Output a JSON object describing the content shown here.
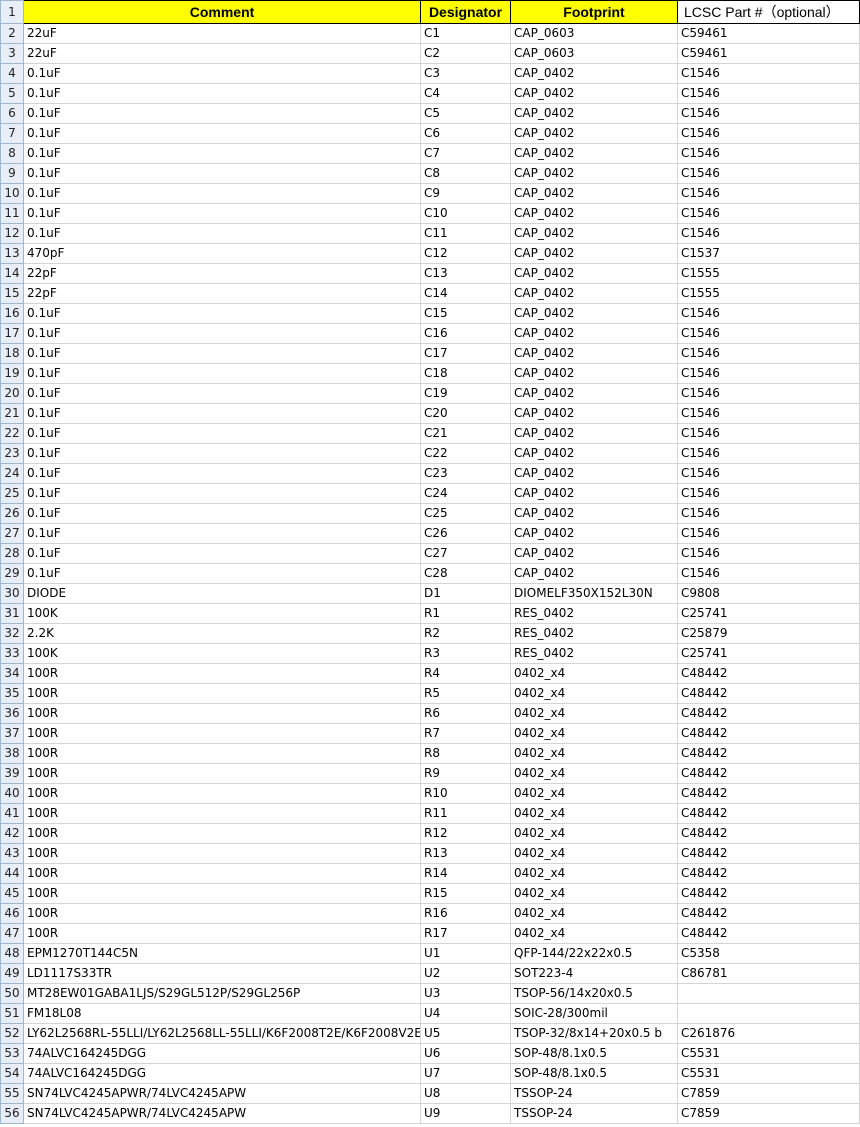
{
  "headers": [
    "Comment",
    "Designator",
    "Footprint",
    "LCSC Part #（optional）"
  ],
  "header_row_number": "1",
  "rows": [
    [
      "2",
      "22uF",
      "C1",
      "CAP_0603",
      "C59461"
    ],
    [
      "3",
      "22uF",
      "C2",
      "CAP_0603",
      "C59461"
    ],
    [
      "4",
      "0.1uF",
      "C3",
      "CAP_0402",
      "C1546"
    ],
    [
      "5",
      "0.1uF",
      "C4",
      "CAP_0402",
      "C1546"
    ],
    [
      "6",
      "0.1uF",
      "C5",
      "CAP_0402",
      "C1546"
    ],
    [
      "7",
      "0.1uF",
      "C6",
      "CAP_0402",
      "C1546"
    ],
    [
      "8",
      "0.1uF",
      "C7",
      "CAP_0402",
      "C1546"
    ],
    [
      "9",
      "0.1uF",
      "C8",
      "CAP_0402",
      "C1546"
    ],
    [
      "10",
      "0.1uF",
      "C9",
      "CAP_0402",
      "C1546"
    ],
    [
      "11",
      "0.1uF",
      "C10",
      "CAP_0402",
      "C1546"
    ],
    [
      "12",
      "0.1uF",
      "C11",
      "CAP_0402",
      "C1546"
    ],
    [
      "13",
      "470pF",
      "C12",
      "CAP_0402",
      "C1537"
    ],
    [
      "14",
      "22pF",
      "C13",
      "CAP_0402",
      "C1555"
    ],
    [
      "15",
      "22pF",
      "C14",
      "CAP_0402",
      "C1555"
    ],
    [
      "16",
      "0.1uF",
      "C15",
      "CAP_0402",
      "C1546"
    ],
    [
      "17",
      "0.1uF",
      "C16",
      "CAP_0402",
      "C1546"
    ],
    [
      "18",
      "0.1uF",
      "C17",
      "CAP_0402",
      "C1546"
    ],
    [
      "19",
      "0.1uF",
      "C18",
      "CAP_0402",
      "C1546"
    ],
    [
      "20",
      "0.1uF",
      "C19",
      "CAP_0402",
      "C1546"
    ],
    [
      "21",
      "0.1uF",
      "C20",
      "CAP_0402",
      "C1546"
    ],
    [
      "22",
      "0.1uF",
      "C21",
      "CAP_0402",
      "C1546"
    ],
    [
      "23",
      "0.1uF",
      "C22",
      "CAP_0402",
      "C1546"
    ],
    [
      "24",
      "0.1uF",
      "C23",
      "CAP_0402",
      "C1546"
    ],
    [
      "25",
      "0.1uF",
      "C24",
      "CAP_0402",
      "C1546"
    ],
    [
      "26",
      "0.1uF",
      "C25",
      "CAP_0402",
      "C1546"
    ],
    [
      "27",
      "0.1uF",
      "C26",
      "CAP_0402",
      "C1546"
    ],
    [
      "28",
      "0.1uF",
      "C27",
      "CAP_0402",
      "C1546"
    ],
    [
      "29",
      "0.1uF",
      "C28",
      "CAP_0402",
      "C1546"
    ],
    [
      "30",
      "DIODE",
      "D1",
      "DIOMELF350X152L30N",
      "C9808"
    ],
    [
      "31",
      "100K",
      "R1",
      "RES_0402",
      "C25741"
    ],
    [
      "32",
      "2.2K",
      "R2",
      "RES_0402",
      "C25879"
    ],
    [
      "33",
      "100K",
      "R3",
      "RES_0402",
      "C25741"
    ],
    [
      "34",
      "100R",
      "R4",
      "0402_x4",
      "C48442"
    ],
    [
      "35",
      "100R",
      "R5",
      "0402_x4",
      "C48442"
    ],
    [
      "36",
      "100R",
      "R6",
      "0402_x4",
      "C48442"
    ],
    [
      "37",
      "100R",
      "R7",
      "0402_x4",
      "C48442"
    ],
    [
      "38",
      "100R",
      "R8",
      "0402_x4",
      "C48442"
    ],
    [
      "39",
      "100R",
      "R9",
      "0402_x4",
      "C48442"
    ],
    [
      "40",
      "100R",
      "R10",
      "0402_x4",
      "C48442"
    ],
    [
      "41",
      "100R",
      "R11",
      "0402_x4",
      "C48442"
    ],
    [
      "42",
      "100R",
      "R12",
      "0402_x4",
      "C48442"
    ],
    [
      "43",
      "100R",
      "R13",
      "0402_x4",
      "C48442"
    ],
    [
      "44",
      "100R",
      "R14",
      "0402_x4",
      "C48442"
    ],
    [
      "45",
      "100R",
      "R15",
      "0402_x4",
      "C48442"
    ],
    [
      "46",
      "100R",
      "R16",
      "0402_x4",
      "C48442"
    ],
    [
      "47",
      "100R",
      "R17",
      "0402_x4",
      "C48442"
    ],
    [
      "48",
      "EPM1270T144C5N",
      "U1",
      "QFP-144/22x22x0.5",
      "C5358"
    ],
    [
      "49",
      "LD1117S33TR",
      "U2",
      "SOT223-4",
      "C86781"
    ],
    [
      "50",
      "MT28EW01GABA1LJS/S29GL512P/S29GL256P",
      "U3",
      "TSOP-56/14x20x0.5",
      ""
    ],
    [
      "51",
      "FM18L08",
      "U4",
      "SOIC-28/300mil",
      ""
    ],
    [
      "52",
      "LY62L2568RL-55LLI/LY62L2568LL-55LLI/K6F2008T2E/K6F2008V2E",
      "U5",
      "TSOP-32/8x14+20x0.5 b",
      "C261876"
    ],
    [
      "53",
      "74ALVC164245DGG",
      "U6",
      "SOP-48/8.1x0.5",
      "C5531"
    ],
    [
      "54",
      "74ALVC164245DGG",
      "U7",
      "SOP-48/8.1x0.5",
      "C5531"
    ],
    [
      "55",
      "SN74LVC4245APWR/74LVC4245APW",
      "U8",
      "TSSOP-24",
      "C7859"
    ],
    [
      "56",
      "SN74LVC4245APWR/74LVC4245APW",
      "U9",
      "TSSOP-24",
      "C7859"
    ]
  ]
}
